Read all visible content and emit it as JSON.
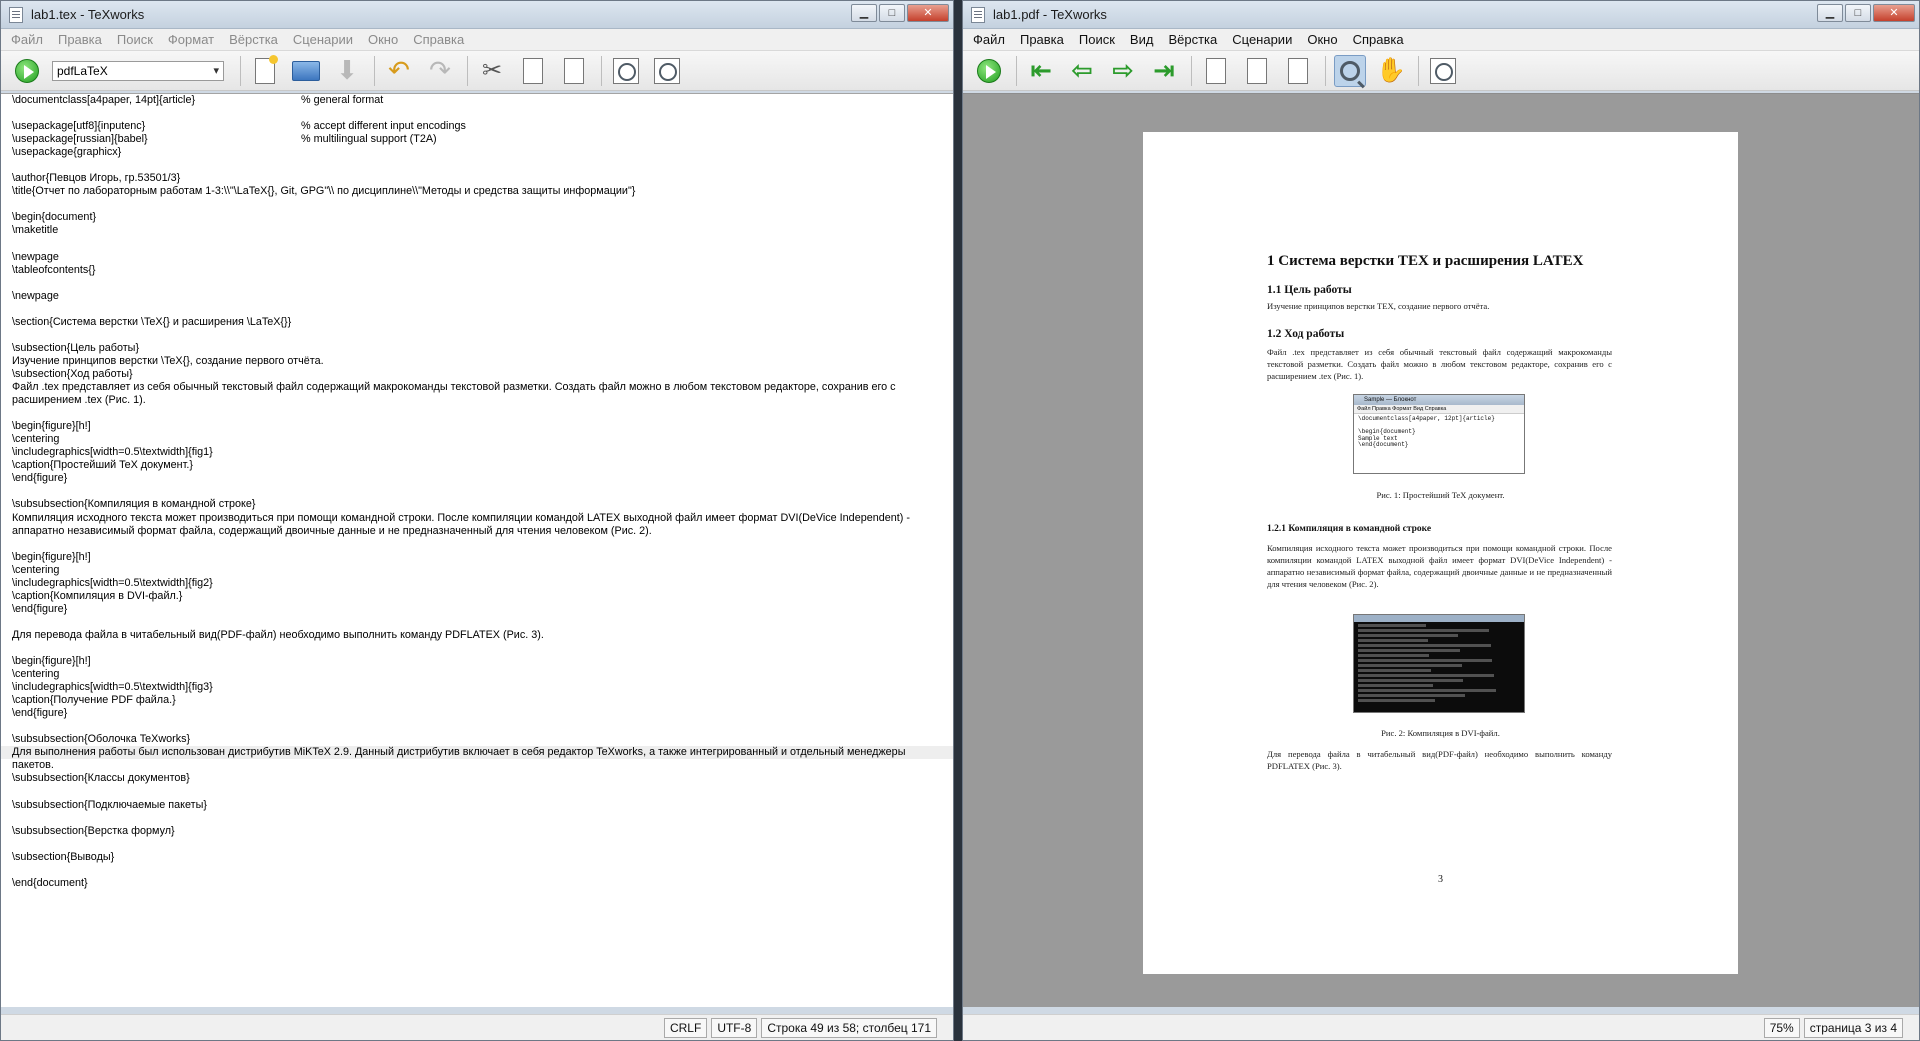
{
  "editor": {
    "title": "lab1.tex - TeXworks",
    "menu": [
      "Файл",
      "Правка",
      "Поиск",
      "Формат",
      "Вёрстка",
      "Сценарии",
      "Окно",
      "Справка"
    ],
    "engine": "pdfLaTeX",
    "lines": [
      "\\documentclass[a4paper, 14pt]{article}",
      "",
      "\\usepackage[utf8]{inputenc}",
      "\\usepackage[russian]{babel}",
      "\\usepackage{graphicx}",
      "",
      "\\author{Певцов Игорь, гр.53501/3}",
      "\\title{Отчет по лабораторным работам 1-3:\\\\\"\\LaTeX{}, Git, GPG\"\\\\ по дисциплине\\\\\"Методы и средства защиты информации\"}",
      "",
      "\\begin{document}",
      "\\maketitle",
      "",
      "\\newpage",
      "\\tableofcontents{}",
      "",
      "\\newpage",
      "",
      "\\section{Система верстки \\TeX{} и расширения \\LaTeX{}}",
      "",
      "\\subsection{Цель работы}",
      "Изучение принципов верстки \\TeX{}, создание первого отчёта.",
      "\\subsection{Ход работы}",
      "Файл .tex представляет из себя обычный текстовый файл содержащий макрокоманды текстовой разметки. Создать файл можно в любом текстовом редакторе, сохранив его с",
      "расширением .tex (Рис. 1).",
      "",
      "\\begin{figure}[h!]",
      "\\centering",
      "\\includegraphics[width=0.5\\textwidth]{fig1}",
      "\\caption{Простейший TeX документ.}",
      "\\end{figure}",
      "",
      "\\subsubsection{Компиляция в командной строке}",
      "Компиляция исходного текста может производиться при помощи командной строки. После компиляции командой LATEX выходной файл имеет формат DVI(DeVice Independent) -",
      "аппаратно независимый формат файла, содержащий двоичные данные и не предназначенный для чтения человеком (Рис. 2).",
      "",
      "\\begin{figure}[h!]",
      "\\centering",
      "\\includegraphics[width=0.5\\textwidth]{fig2}",
      "\\caption{Компиляция в DVI-файл.}",
      "\\end{figure}",
      "",
      "Для перевода файла в читабельный вид(PDF-файл) необходимо выполнить команду PDFLATEX (Рис. 3).",
      "",
      "\\begin{figure}[h!]",
      "\\centering",
      "\\includegraphics[width=0.5\\textwidth]{fig3}",
      "\\caption{Получение PDF файла.}",
      "\\end{figure}",
      "",
      "\\subsubsection{Оболочка TeXworks}",
      "Для выполнения работы был использован дистрибутив MiKTeX 2.9. Данный дистрибутив включает в себя редактор TeXworks, а также интегрированный и отдельный менеджеры",
      "пакетов.",
      "\\subsubsection{Классы документов}",
      "",
      "\\subsubsection{Подключаемые пакеты}",
      "",
      "\\subsubsection{Верстка формул}",
      "",
      "\\subsection{Выводы}",
      "",
      "\\end{document}"
    ],
    "comments": {
      "c0": "% general format",
      "c2": "% accept different input encodings",
      "c3": "% multilingual support (T2A)"
    },
    "status": {
      "eol": "CRLF",
      "encoding": "UTF-8",
      "position": "Строка 49 из 58; столбец 171"
    }
  },
  "viewer": {
    "title": "lab1.pdf - TeXworks",
    "menu": [
      "Файл",
      "Правка",
      "Поиск",
      "Вид",
      "Вёрстка",
      "Сценарии",
      "Окно",
      "Справка"
    ],
    "page": {
      "section": "1    Система верстки TEX и расширения LATEX",
      "sub1": "1.1    Цель работы",
      "sub1_text": "Изучение принципов верстки TEX, создание первого отчёта.",
      "sub2": "1.2    Ход работы",
      "sub2_text": "Файл .tex представляет из себя обычный текстовый файл содержащий макрокоманды текстовой разметки. Создать файл можно в любом текстовом редакторе, сохранив его с расширением .tex (Рис. 1).",
      "fig1_title": "Sample — Блокнот",
      "fig1_menu": "Файл  Правка  Формат  Вид  Справка",
      "fig1_body": "\\documentclass[a4paper, 12pt]{article}\n\n\\begin{document}\nSample text\n\\end{document}",
      "cap1": "Рис. 1: Простейший TeX документ.",
      "subsub": "1.2.1    Компиляция в командной строке",
      "subsub_text": "Компиляция исходного текста может производиться при помощи командной строки. После компиляции командой LATEX выходной файл имеет формат DVI(DeVice Independent) - аппаратно независимый формат файла, содержащий двоичные данные и не предназначенный для чтения человеком (Рис. 2).",
      "cap2": "Рис. 2: Компиляция в DVI-файл.",
      "para3": "Для перевода файла в читабельный вид(PDF-файл) необходимо выполнить команду PDFLATEX (Рис. 3).",
      "number": "3"
    },
    "status": {
      "zoom": "75%",
      "page": "страница 3 из 4"
    }
  }
}
